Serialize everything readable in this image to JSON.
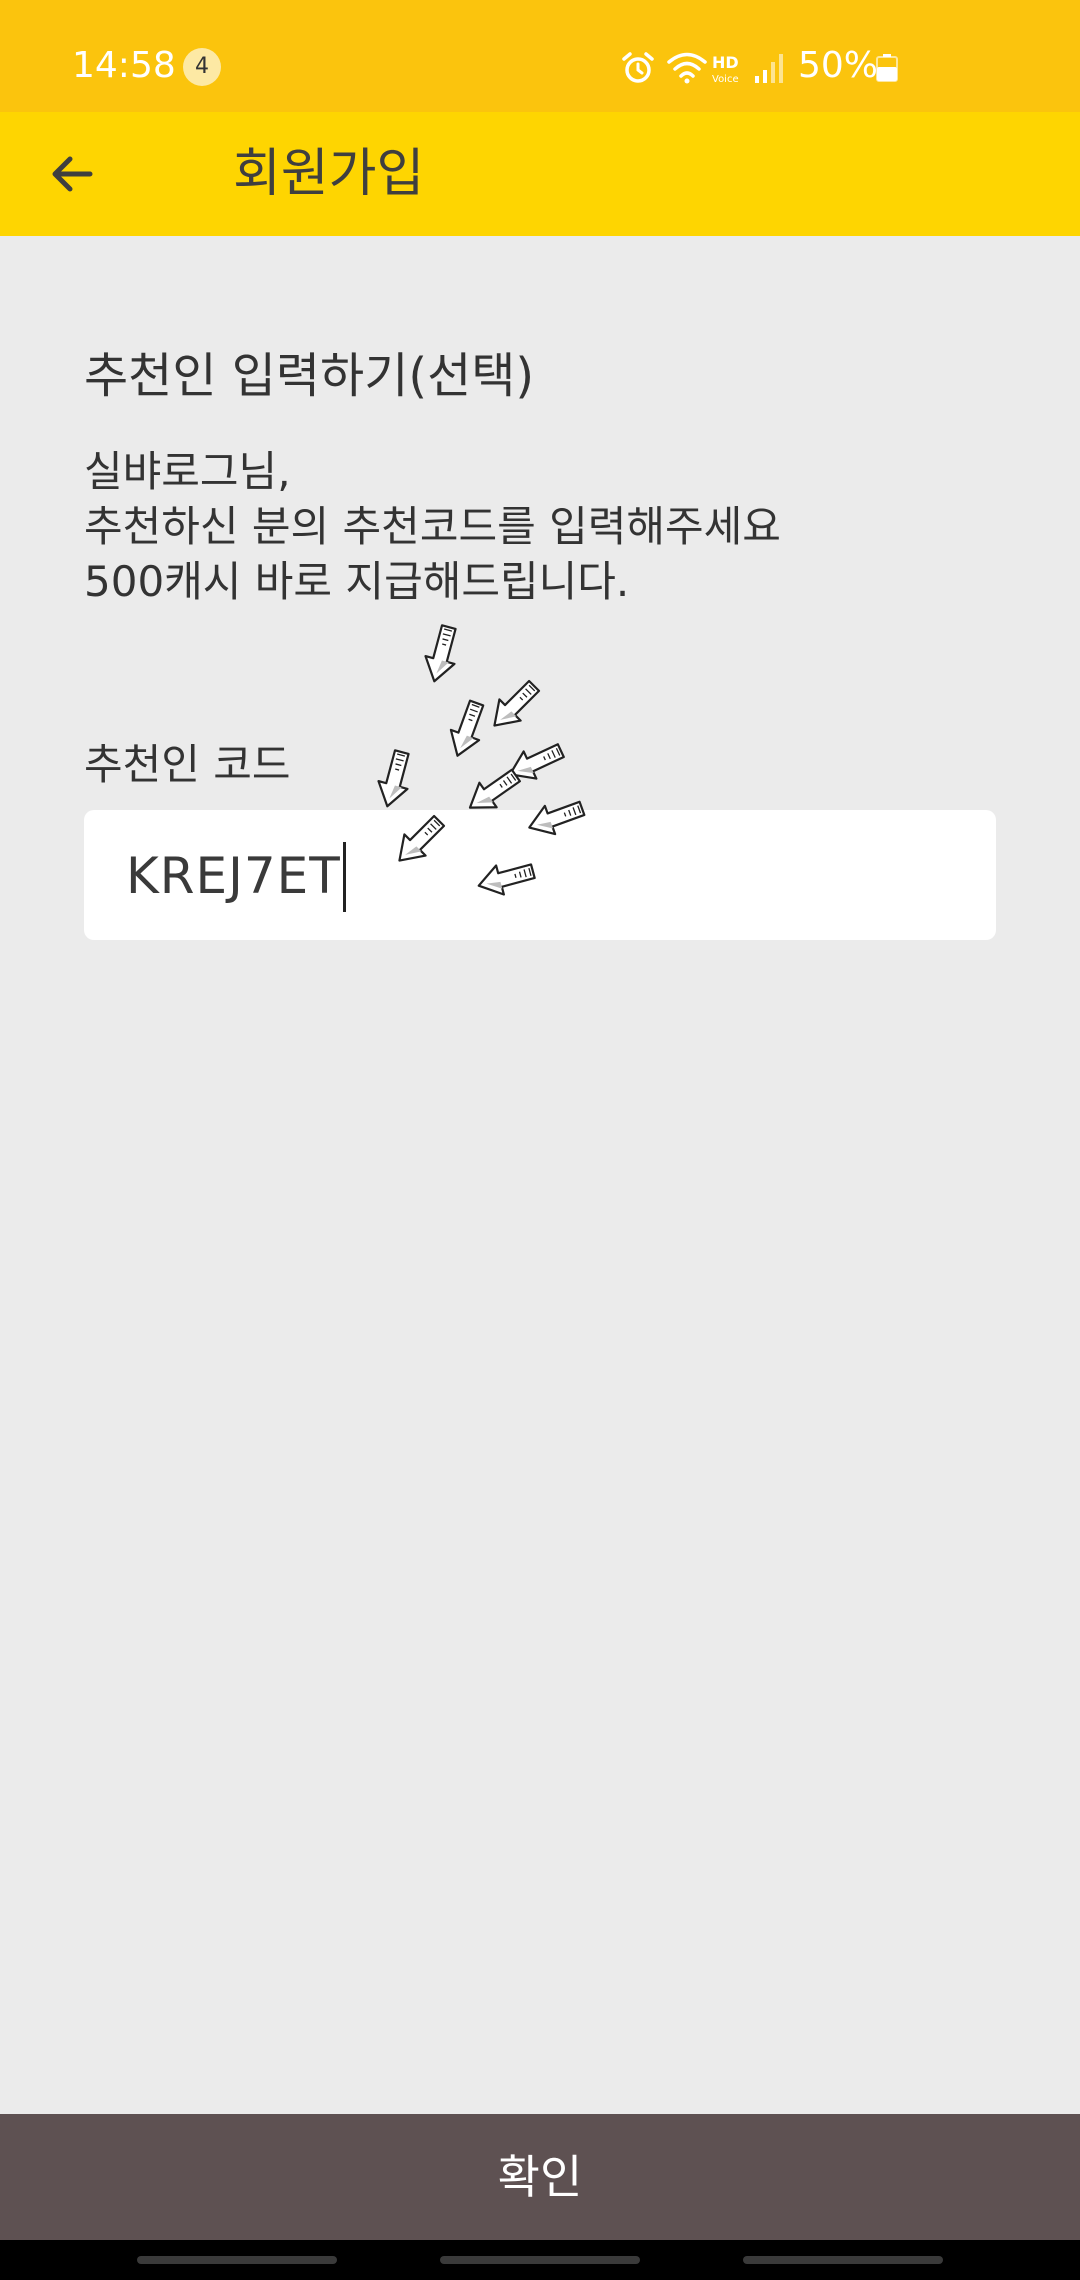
{
  "status_bar": {
    "time": "14:58",
    "notification_count": "4",
    "battery_percent": "50%",
    "icons": [
      "alarm-icon",
      "wifi-icon",
      "hd-voice-icon",
      "signal-icon",
      "battery-icon"
    ]
  },
  "app_bar": {
    "title": "회원가입",
    "back_icon": "arrow-left-icon"
  },
  "main": {
    "section_title": "추천인 입력하기(선택)",
    "description_lines": [
      "실뱌로그님,",
      "추천하신 분의 추천코드를 입력해주세요",
      "500캐시 바로 지급해드립니다."
    ],
    "code_label": "추천인 코드",
    "code_value": "KREJ7ET"
  },
  "bottom": {
    "confirm_label": "확인"
  },
  "colors": {
    "status_bar": "#fbc40d",
    "app_bar": "#fed501",
    "background": "#ebebeb",
    "confirm_button": "#5e5152"
  }
}
